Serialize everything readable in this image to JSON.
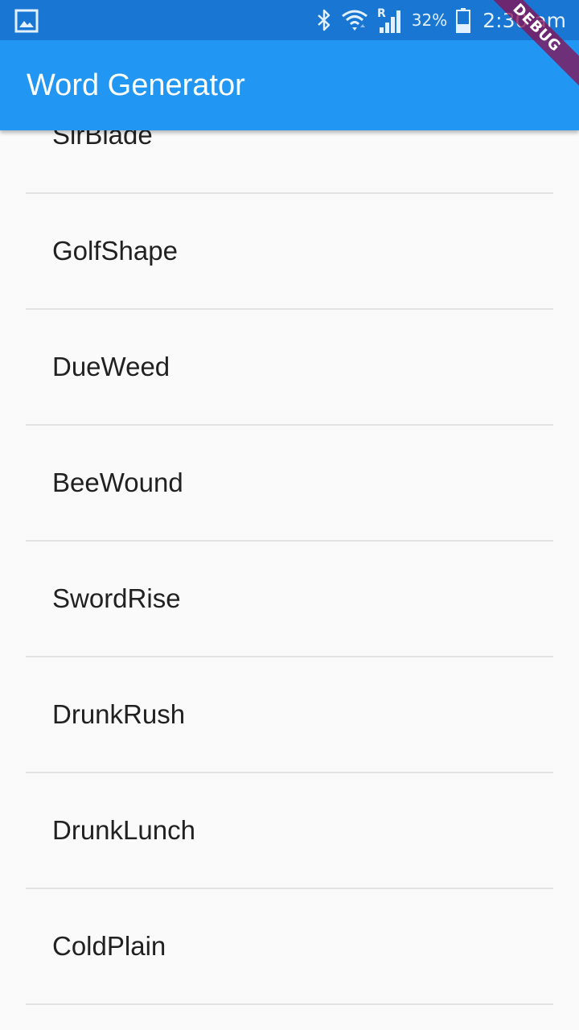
{
  "status_bar": {
    "battery_percent": "32%",
    "time": "2:30 am",
    "icons": [
      "gallery-icon",
      "bluetooth-icon",
      "wifi-icon",
      "signal-icon",
      "battery-icon"
    ],
    "background_color": "#1976d2"
  },
  "app_bar": {
    "title": "Word Generator",
    "background_color": "#2196f3"
  },
  "debug_banner": {
    "label": "DEBUG"
  },
  "word_list": {
    "items": [
      "SirBlade",
      "GolfShape",
      "DueWeed",
      "BeeWound",
      "SwordRise",
      "DrunkRush",
      "DrunkLunch",
      "ColdPlain"
    ]
  }
}
